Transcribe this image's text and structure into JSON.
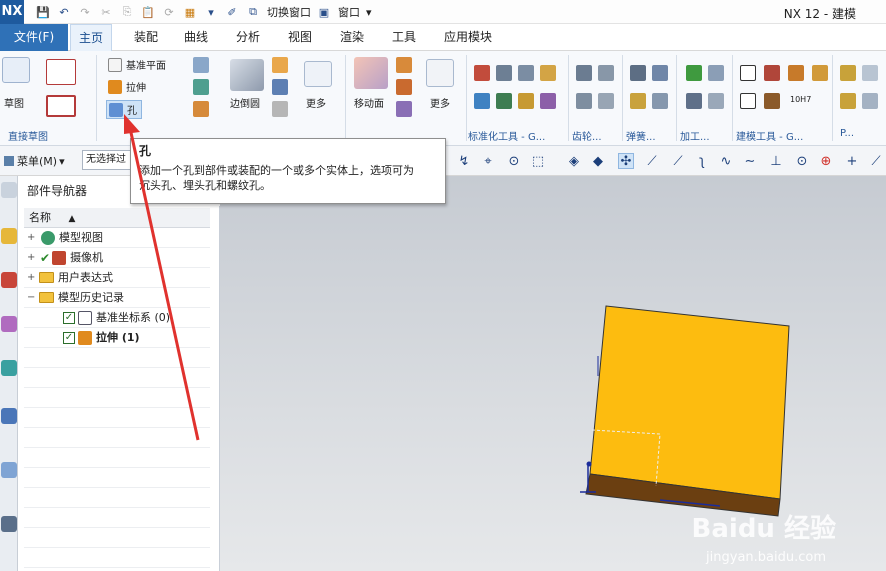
{
  "app": {
    "logo": "NX",
    "title": "NX 12 - 建模"
  },
  "quick_access": {
    "switch_window": "切换窗口",
    "window": "窗口",
    "window_arrow": "▾"
  },
  "tabs": [
    "文件(F)",
    "主页",
    "装配",
    "曲线",
    "分析",
    "视图",
    "渲染",
    "工具",
    "应用模块"
  ],
  "active_tab": "主页",
  "ribbon": {
    "sketch": "草图",
    "direct_sketch_group": "直接草图",
    "datum_plane": "基准平面",
    "extrude": "拉伸",
    "hole": "孔",
    "edge_blend": "边倒圆",
    "more_1": "更多",
    "move_face": "移动面",
    "more_2": "更多",
    "std_tools_group": "标准化工具 - G...",
    "gear_group": "齿轮...",
    "spring_group": "弹簧...",
    "process_group": "加工...",
    "modeling_tools_group": "建模工具 - G...",
    "p_group": "P...",
    "tol_label": "10H7"
  },
  "toolbar": {
    "menu": "菜单(M)",
    "menu_arrow": "▾",
    "filter": "无选择过"
  },
  "tooltip": {
    "title": "孔",
    "text_line1": "添加一个孔到部件或装配的一个或多个实体上，选项可为",
    "text_line2": "沉头孔、埋头孔和螺纹孔。"
  },
  "navigator": {
    "title": "部件导航器",
    "column": "名称",
    "sort_arrow": "▲",
    "rows": [
      {
        "expander": "+",
        "label": "模型视图"
      },
      {
        "expander": "+",
        "label": "摄像机"
      },
      {
        "expander": "+",
        "label": "用户表达式"
      },
      {
        "expander": "−",
        "label": "模型历史记录"
      },
      {
        "label": "基准坐标系 (0)"
      },
      {
        "label": "拉伸 (1)"
      }
    ]
  },
  "watermark": {
    "brand": "Baidu 经验",
    "site": "jingyan.baidu.com"
  },
  "colors": {
    "accent": "#2f71b7",
    "block_face": "#FDBC0F",
    "block_side": "#6B3F11",
    "arrow": "#E0322E"
  }
}
